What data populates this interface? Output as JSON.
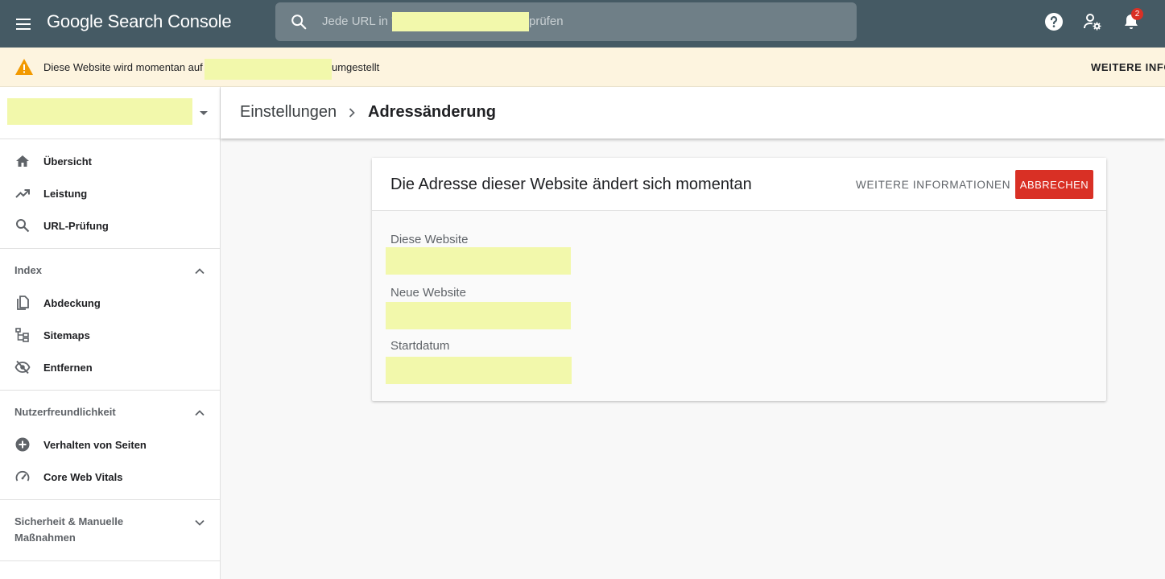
{
  "app": {
    "title": "Google Search Console"
  },
  "search": {
    "prefix": "Jede URL in \"",
    "suffix": "prüfen"
  },
  "notifications": {
    "count": "2"
  },
  "banner": {
    "text_prefix": "Diese Website wird momentan auf",
    "text_suffix": "umgestellt",
    "more_label": "WEITERE INFO"
  },
  "sidebar": {
    "top_items": [
      {
        "label": "Übersicht",
        "icon": "home-icon"
      },
      {
        "label": "Leistung",
        "icon": "trending-up-icon"
      },
      {
        "label": "URL-Prüfung",
        "icon": "search-icon"
      }
    ],
    "sections": [
      {
        "label": "Index",
        "expanded": true,
        "items": [
          {
            "label": "Abdeckung",
            "icon": "pages-icon"
          },
          {
            "label": "Sitemaps",
            "icon": "sitemap-icon"
          },
          {
            "label": "Entfernen",
            "icon": "visibility-off-icon"
          }
        ]
      },
      {
        "label": "Nutzerfreundlichkeit",
        "expanded": true,
        "items": [
          {
            "label": "Verhalten von Seiten",
            "icon": "plus-circle-icon"
          },
          {
            "label": "Core Web Vitals",
            "icon": "speedometer-icon"
          }
        ]
      },
      {
        "label": "Sicherheit & Manuelle Maßnahmen",
        "expanded": false,
        "items": []
      }
    ]
  },
  "header": {
    "breadcrumb": [
      "Einstellungen",
      "Adressänderung"
    ]
  },
  "card": {
    "title": "Die Adresse dieser Website ändert sich momentan",
    "more_label": "WEITERE INFORMATIONEN",
    "cancel_label": "ABBRECHEN",
    "fields": [
      {
        "label": "Diese Website"
      },
      {
        "label": "Neue Website"
      },
      {
        "label": "Startdatum"
      }
    ]
  },
  "colors": {
    "topbar": "#455a64",
    "banner": "#fdf4df",
    "accent_red": "#d93025",
    "redaction": "#f2f8ab"
  }
}
